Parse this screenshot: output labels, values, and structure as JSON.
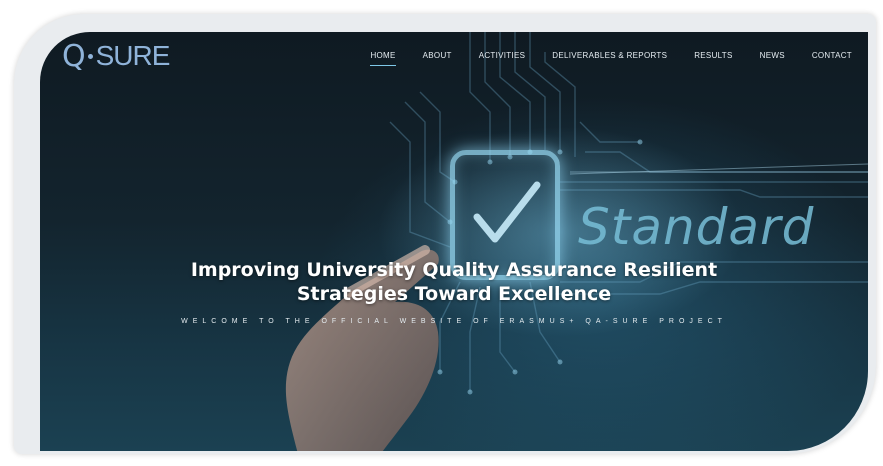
{
  "logo": {
    "letter": "Q",
    "text": "SURE",
    "icon": "q-sure-logo-icon"
  },
  "nav": {
    "items": [
      {
        "label": "HOME",
        "active": true
      },
      {
        "label": "ABOUT",
        "active": false
      },
      {
        "label": "ACTIVITIES",
        "active": false
      },
      {
        "label": "DELIVERABLES & REPORTS",
        "active": false
      },
      {
        "label": "RESULTS",
        "active": false
      },
      {
        "label": "NEWS",
        "active": false
      },
      {
        "label": "CONTACT",
        "active": false
      }
    ]
  },
  "hero": {
    "title_line1": "Improving University Quality Assurance Resilient",
    "title_line2": "Strategies Toward Excellence",
    "subtitle": "WELCOME TO THE OFFICIAL WEBSITE OF ERASMUS+ QA-SURE PROJECT",
    "background_word": "Standard"
  },
  "colors": {
    "accent": "#7fc8e8",
    "logo": "#8fb3d9",
    "background_dark": "#0f1a22"
  }
}
